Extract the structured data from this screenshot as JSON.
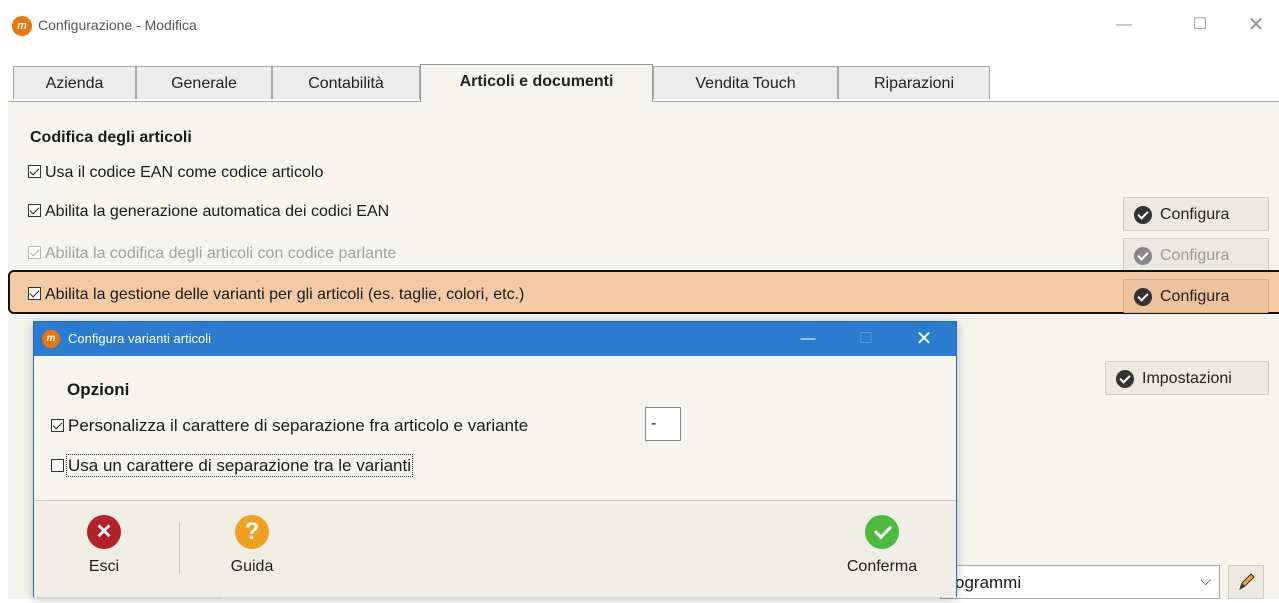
{
  "window": {
    "title": "Configurazione - Modifica",
    "controls": {
      "minimize": "—",
      "maximize": "☐",
      "close": "✕"
    }
  },
  "tabs": [
    {
      "label": "Azienda"
    },
    {
      "label": "Generale"
    },
    {
      "label": "Contabilità"
    },
    {
      "label": "Articoli e documenti",
      "active": true
    },
    {
      "label": "Vendita Touch"
    },
    {
      "label": "Riparazioni"
    }
  ],
  "section": {
    "title": "Codifica degli articoli",
    "options": [
      {
        "label": "Usa il codice EAN come codice articolo",
        "checked": true
      },
      {
        "label": "Abilita la generazione automatica dei codici EAN",
        "checked": true,
        "button": "Configura"
      },
      {
        "label": "Abilita la codifica degli articoli con codice parlante",
        "checked": true,
        "disabled": true,
        "button": "Configura"
      },
      {
        "label": "Abilita la gestione delle varianti per gli articoli (es. taglie, colori, etc.)",
        "checked": true,
        "highlighted": true,
        "button": "Configura"
      }
    ],
    "impostazioni_button": "Impostazioni"
  },
  "bottom_combo": {
    "value": "ogrammi"
  },
  "dialog": {
    "title": "Configura varianti articoli",
    "options_title": "Opzioni",
    "options": [
      {
        "label": "Personalizza il carattere di separazione fra articolo e variante",
        "checked": true,
        "input_value": "-"
      },
      {
        "label": "Usa un carattere di separazione tra le varianti",
        "checked": false
      }
    ],
    "toolbar": {
      "exit": "Esci",
      "help": "Guida",
      "confirm": "Conferma"
    }
  },
  "colors": {
    "highlight": "#f3caa4",
    "dialog_title_bar": "#2b7bd1",
    "app_icon": "#e8760a"
  }
}
